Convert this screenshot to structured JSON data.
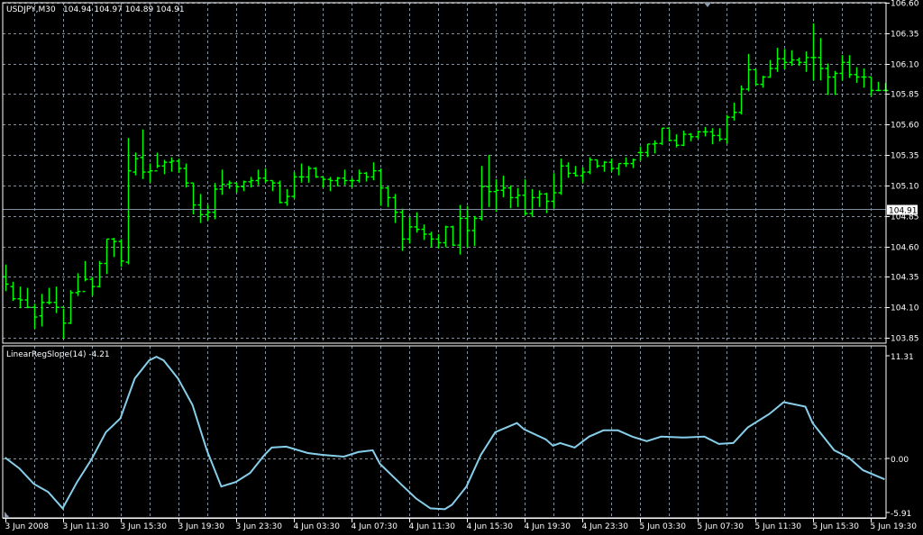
{
  "header": {
    "symbol_label": "USDJPY,M30",
    "ohlc_text": "104.94 104.97 104.89 104.91"
  },
  "indicator_header": "LinearRegSlope(14) -4.21",
  "current_price_label": "104.91",
  "colors": {
    "background": "#000000",
    "bars": "#00ff00",
    "grid": "#8090a0",
    "indicator_line": "#87ceeb",
    "bid_line": "#7f8fa0",
    "axis_text": "#ffffff"
  },
  "chart_data": [
    {
      "type": "ohlc-bar",
      "symbol": "USDJPY",
      "timeframe": "M30",
      "y_ticks": [
        "106.60",
        "106.35",
        "106.10",
        "105.85",
        "105.60",
        "105.35",
        "105.10",
        "104.85",
        "104.60",
        "104.35",
        "104.10",
        "103.85"
      ],
      "ylim": [
        103.85,
        106.6
      ],
      "grid": true,
      "current_price": 104.91,
      "x_tick_labels": [
        "3 Jun 2008",
        "3 Jun 11:30",
        "3 Jun 15:30",
        "3 Jun 19:30",
        "3 Jun 23:30",
        "4 Jun 03:30",
        "4 Jun 07:30",
        "4 Jun 11:30",
        "4 Jun 15:30",
        "4 Jun 19:30",
        "4 Jun 23:30",
        "5 Jun 03:30",
        "5 Jun 07:30",
        "5 Jun 11:30",
        "5 Jun 15:30",
        "5 Jun 19:30"
      ],
      "ohlc": [
        [
          104.35,
          104.45,
          104.24,
          104.29
        ],
        [
          104.27,
          104.31,
          104.16,
          104.17
        ],
        [
          104.17,
          104.27,
          104.1,
          104.16
        ],
        [
          104.16,
          104.26,
          104.1,
          104.1
        ],
        [
          104.1,
          104.13,
          103.93,
          104.02
        ],
        [
          104.03,
          104.21,
          103.95,
          104.14
        ],
        [
          104.14,
          104.26,
          104.13,
          104.14
        ],
        [
          104.14,
          104.27,
          104.06,
          104.1
        ],
        [
          104.1,
          104.09,
          103.85,
          103.97
        ],
        [
          103.97,
          104.24,
          103.97,
          104.22
        ],
        [
          104.22,
          104.38,
          104.2,
          104.23
        ],
        [
          104.23,
          104.48,
          104.32,
          104.33
        ],
        [
          104.33,
          104.35,
          104.2,
          104.27
        ],
        [
          104.27,
          104.48,
          104.27,
          104.46
        ],
        [
          104.46,
          104.66,
          104.38,
          104.66
        ],
        [
          104.66,
          104.67,
          104.52,
          104.64
        ],
        [
          104.64,
          104.66,
          104.44,
          104.48
        ],
        [
          104.47,
          105.49,
          104.46,
          105.22
        ],
        [
          105.21,
          105.37,
          105.19,
          105.32
        ],
        [
          105.33,
          105.56,
          105.16,
          105.21
        ],
        [
          105.21,
          105.28,
          105.13,
          105.22
        ],
        [
          105.22,
          105.37,
          105.25,
          105.26
        ],
        [
          105.26,
          105.31,
          105.2,
          105.29
        ],
        [
          105.29,
          105.33,
          105.22,
          105.3
        ],
        [
          105.3,
          105.32,
          105.21,
          105.24
        ],
        [
          105.24,
          105.28,
          105.09,
          105.12
        ],
        [
          105.12,
          105.12,
          104.87,
          104.94
        ],
        [
          104.94,
          105.03,
          104.8,
          104.86
        ],
        [
          104.86,
          104.94,
          104.82,
          104.88
        ],
        [
          104.88,
          105.12,
          104.83,
          105.07
        ],
        [
          105.07,
          105.23,
          105.03,
          105.11
        ],
        [
          105.11,
          105.14,
          105.08,
          105.12
        ],
        [
          105.12,
          105.12,
          105.05,
          105.09
        ],
        [
          105.09,
          105.14,
          105.06,
          105.13
        ],
        [
          105.13,
          105.17,
          105.09,
          105.14
        ],
        [
          105.14,
          105.23,
          105.11,
          105.16
        ],
        [
          105.16,
          105.24,
          105.13,
          105.14
        ],
        [
          105.14,
          105.14,
          105.06,
          105.12
        ],
        [
          105.12,
          105.14,
          104.96,
          104.96
        ],
        [
          104.96,
          105.07,
          104.94,
          105.01
        ],
        [
          105.01,
          105.21,
          105.0,
          105.17
        ],
        [
          105.17,
          105.28,
          105.13,
          105.17
        ],
        [
          105.17,
          105.26,
          105.13,
          105.24
        ],
        [
          105.24,
          105.25,
          105.17,
          105.17
        ],
        [
          105.17,
          105.17,
          105.09,
          105.15
        ],
        [
          105.15,
          105.17,
          105.06,
          105.14
        ],
        [
          105.14,
          105.17,
          105.1,
          105.16
        ],
        [
          105.16,
          105.23,
          105.11,
          105.14
        ],
        [
          105.14,
          105.16,
          105.09,
          105.14
        ],
        [
          105.14,
          105.23,
          105.13,
          105.2
        ],
        [
          105.2,
          105.21,
          105.14,
          105.17
        ],
        [
          105.17,
          105.29,
          105.15,
          105.22
        ],
        [
          105.22,
          105.24,
          104.94,
          105.08
        ],
        [
          105.08,
          105.09,
          104.93,
          105.0
        ],
        [
          105.0,
          105.03,
          104.8,
          104.88
        ],
        [
          104.88,
          104.91,
          104.57,
          104.66
        ],
        [
          104.66,
          104.84,
          104.63,
          104.76
        ],
        [
          104.76,
          104.88,
          104.72,
          104.74
        ],
        [
          104.74,
          104.78,
          104.66,
          104.7
        ],
        [
          104.7,
          104.72,
          104.6,
          104.66
        ],
        [
          104.66,
          104.7,
          104.59,
          104.63
        ],
        [
          104.63,
          104.77,
          104.6,
          104.76
        ],
        [
          104.76,
          104.77,
          104.61,
          104.61
        ],
        [
          104.61,
          104.94,
          104.54,
          104.83
        ],
        [
          104.83,
          104.93,
          104.6,
          104.73
        ],
        [
          104.73,
          104.85,
          104.61,
          104.83
        ],
        [
          104.83,
          105.26,
          104.82,
          105.09
        ],
        [
          105.09,
          105.35,
          104.93,
          105.05
        ],
        [
          105.05,
          105.15,
          104.89,
          105.06
        ],
        [
          105.06,
          105.18,
          105.01,
          105.08
        ],
        [
          105.08,
          105.1,
          104.92,
          105.0
        ],
        [
          105.0,
          105.08,
          104.93,
          105.02
        ],
        [
          105.02,
          105.15,
          104.86,
          104.87
        ],
        [
          104.87,
          105.07,
          104.85,
          105.0
        ],
        [
          105.0,
          105.06,
          104.93,
          105.03
        ],
        [
          105.03,
          105.04,
          104.88,
          104.97
        ],
        [
          104.97,
          105.2,
          104.92,
          105.04
        ],
        [
          105.04,
          105.32,
          105.03,
          105.26
        ],
        [
          105.26,
          105.29,
          105.17,
          105.2
        ],
        [
          105.2,
          105.26,
          105.18,
          105.18
        ],
        [
          105.18,
          105.25,
          105.13,
          105.21
        ],
        [
          105.21,
          105.33,
          105.2,
          105.31
        ],
        [
          105.31,
          105.31,
          105.25,
          105.26
        ],
        [
          105.26,
          105.3,
          105.22,
          105.29
        ],
        [
          105.29,
          105.32,
          105.22,
          105.24
        ],
        [
          105.24,
          105.28,
          105.19,
          105.28
        ],
        [
          105.28,
          105.33,
          105.26,
          105.28
        ],
        [
          105.28,
          105.32,
          105.25,
          105.31
        ],
        [
          105.37,
          105.42,
          105.31,
          105.37
        ],
        [
          105.37,
          105.44,
          105.34,
          105.44
        ],
        [
          105.44,
          105.47,
          105.37,
          105.445
        ],
        [
          105.445,
          105.57,
          105.44,
          105.57
        ],
        [
          105.57,
          105.56,
          105.47,
          105.47
        ],
        [
          105.47,
          105.52,
          105.42,
          105.43
        ],
        [
          105.43,
          105.55,
          105.43,
          105.52
        ],
        [
          105.52,
          105.53,
          105.47,
          105.5
        ],
        [
          105.5,
          105.55,
          105.49,
          105.54
        ],
        [
          105.54,
          105.58,
          105.51,
          105.54
        ],
        [
          105.54,
          105.57,
          105.445,
          105.51
        ],
        [
          105.51,
          105.57,
          105.47,
          105.48
        ],
        [
          105.48,
          105.68,
          105.45,
          105.66
        ],
        [
          105.66,
          105.78,
          105.64,
          105.7
        ],
        [
          105.7,
          105.92,
          105.69,
          105.89
        ],
        [
          105.89,
          106.18,
          105.88,
          106.05
        ],
        [
          106.05,
          106.05,
          105.93,
          105.93
        ],
        [
          105.93,
          106.0,
          105.91,
          105.99
        ],
        [
          105.99,
          106.13,
          105.99,
          106.06
        ],
        [
          106.06,
          106.23,
          106.04,
          106.14
        ],
        [
          106.14,
          106.22,
          106.06,
          106.11
        ],
        [
          106.11,
          106.21,
          106.09,
          106.13
        ],
        [
          106.13,
          106.15,
          106.09,
          106.11
        ],
        [
          106.11,
          106.2,
          106.04,
          106.15
        ],
        [
          106.15,
          106.43,
          105.97,
          106.15
        ],
        [
          106.15,
          106.31,
          105.97,
          106.06
        ],
        [
          106.06,
          106.1,
          105.85,
          105.99
        ],
        [
          105.99,
          106.04,
          105.85,
          106.02
        ],
        [
          106.02,
          106.17,
          105.97,
          106.11
        ],
        [
          106.11,
          106.17,
          105.99,
          106.01
        ],
        [
          106.01,
          106.07,
          105.95,
          105.99
        ],
        [
          105.99,
          106.06,
          105.91,
          105.99
        ],
        [
          105.99,
          105.99,
          105.84,
          105.88
        ],
        [
          105.88,
          105.95,
          105.88,
          105.88
        ],
        [
          105.88,
          105.94,
          105.88,
          105.88
        ]
      ]
    },
    {
      "type": "line",
      "name": "LinearRegSlope(14)",
      "y_ticks": [
        "11.31",
        "0.00",
        "-5.91"
      ],
      "ylim": [
        -5.91,
        11.31
      ],
      "points": [
        [
          0,
          0.1
        ],
        [
          2,
          -1.1
        ],
        [
          4,
          -2.8
        ],
        [
          6,
          -3.7
        ],
        [
          8,
          -5.5
        ],
        [
          10,
          -2.6
        ],
        [
          12,
          -0.1
        ],
        [
          14,
          2.9
        ],
        [
          16,
          4.4
        ],
        [
          18,
          8.8
        ],
        [
          20,
          10.8
        ],
        [
          21,
          11.2
        ],
        [
          22,
          10.8
        ],
        [
          24,
          8.8
        ],
        [
          26,
          5.9
        ],
        [
          28,
          0.9
        ],
        [
          30,
          -3.1
        ],
        [
          32,
          -2.6
        ],
        [
          34,
          -1.6
        ],
        [
          36,
          0.4
        ],
        [
          37,
          1.2
        ],
        [
          39,
          1.3
        ],
        [
          42,
          0.6
        ],
        [
          44,
          0.4
        ],
        [
          47,
          0.2
        ],
        [
          49,
          0.7
        ],
        [
          51,
          0.9
        ],
        [
          52,
          -0.6
        ],
        [
          55,
          -2.9
        ],
        [
          57,
          -4.4
        ],
        [
          59,
          -5.5
        ],
        [
          61,
          -5.6
        ],
        [
          62,
          -5.1
        ],
        [
          64,
          -3.1
        ],
        [
          66,
          0.4
        ],
        [
          68,
          2.9
        ],
        [
          71,
          3.9
        ],
        [
          72,
          3.2
        ],
        [
          75,
          2.1
        ],
        [
          76,
          1.4
        ],
        [
          77,
          1.7
        ],
        [
          79,
          1.2
        ],
        [
          81,
          2.4
        ],
        [
          83,
          3.1
        ],
        [
          85,
          3.1
        ],
        [
          87,
          2.4
        ],
        [
          89,
          1.9
        ],
        [
          91,
          2.4
        ],
        [
          94,
          2.3
        ],
        [
          97,
          2.4
        ],
        [
          99,
          1.6
        ],
        [
          101,
          1.7
        ],
        [
          103,
          3.4
        ],
        [
          106,
          4.9
        ],
        [
          108,
          6.2
        ],
        [
          111,
          5.7
        ],
        [
          112,
          3.9
        ],
        [
          115,
          0.9
        ],
        [
          117,
          0.1
        ],
        [
          119,
          -1.3
        ],
        [
          122,
          -2.3
        ]
      ]
    }
  ]
}
